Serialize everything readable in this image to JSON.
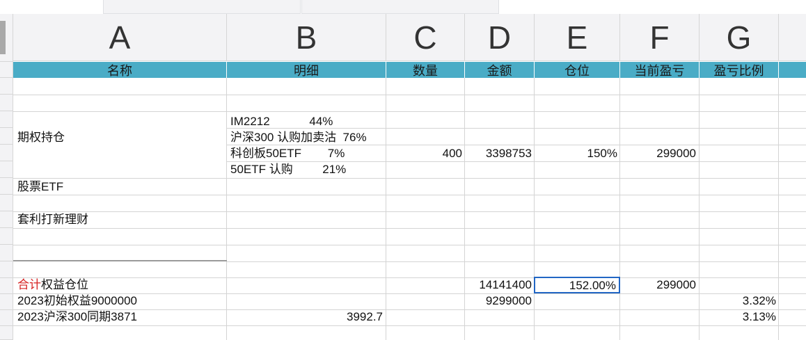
{
  "columns": [
    "A",
    "B",
    "C",
    "D",
    "E",
    "F",
    "G"
  ],
  "header_row": [
    "名称",
    "明细",
    "数量",
    "金额",
    "仓位",
    "当前盈亏",
    "盈亏比例"
  ],
  "colors": {
    "header_band": "#4aacc6",
    "selection": "#2166c4",
    "red_text": "#d62222"
  },
  "cells": {
    "b_im2212": "IM2212            44%",
    "a_options": "期权持仓",
    "b_hs300": "沪深300 认购加卖沽  76%",
    "b_kcb": "科创板50ETF        7%",
    "c_qty": "400",
    "d_amount": "3398753",
    "e_pos": "150%",
    "f_pnl": "299000",
    "b_50etf": "50ETF 认购         21%",
    "a_stock": "股票ETF",
    "a_arb": "套利打新理财",
    "a_total_red": "合计",
    "a_total_rest": "权益仓位",
    "d_total": "14141400",
    "e_total": "152.00%",
    "f_total": "299000",
    "a_initial": "2023初始权益9000000",
    "d_initial": "9299000",
    "g_initial": "3.32%",
    "a_hs300": "2023沪深300同期3871",
    "b_hs300_val": "3992.7",
    "g_hs300": "3.13%"
  }
}
